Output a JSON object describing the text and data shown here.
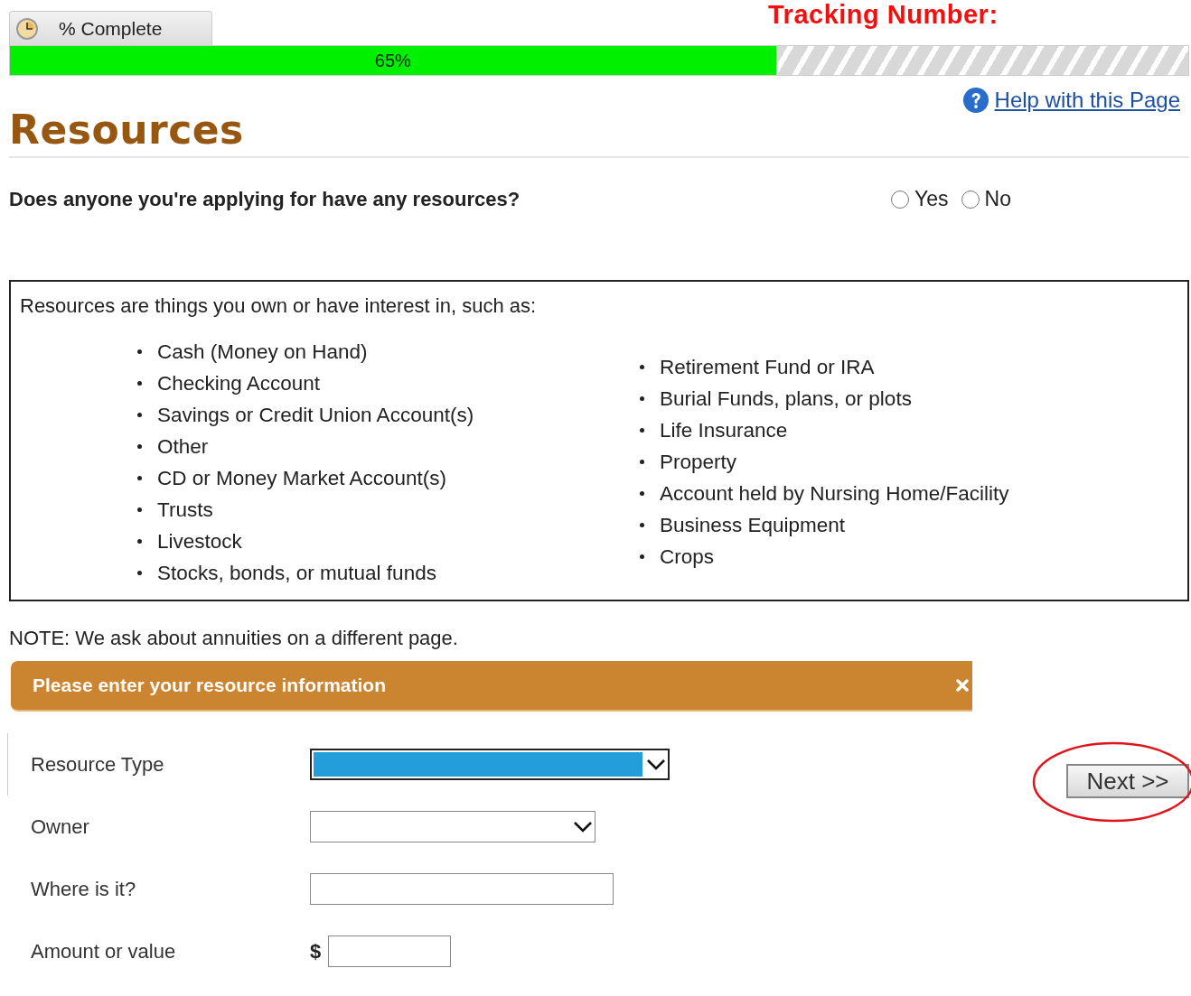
{
  "progress": {
    "tab_label": "% Complete",
    "level": 0.65,
    "reading": "65%"
  },
  "tracking": {
    "label": "Tracking Number:"
  },
  "help_link": "Help with this Page",
  "heading": "Resources",
  "question": {
    "text": "Does anyone you're applying for have any resources?",
    "options": [
      {
        "label": "Yes",
        "selected": false
      },
      {
        "label": "No",
        "selected": false
      }
    ]
  },
  "info_box": {
    "intro": "Resources are things you own or have interest in, such as:",
    "column_1": [
      "Cash (Money on Hand)",
      "Checking Account",
      "Savings or Credit Union Account(s)",
      "Other",
      "CD or Money Market Account(s)",
      "Trusts",
      "Livestock",
      "Stocks, bonds, or mutual funds"
    ],
    "column_2": [
      "Retirement Fund or IRA",
      "Burial Funds, plans, or plots",
      "Life Insurance",
      "Property",
      "Account held by Nursing Home/Facility",
      "Business Equipment",
      "Crops"
    ]
  },
  "note": "NOTE: We ask about annuities on a different page.",
  "panel": {
    "title": "Please enter your resource information"
  },
  "fields": [
    {
      "label": "Resource Type",
      "kind": "select",
      "focused": true
    },
    {
      "label": "Owner",
      "kind": "select",
      "focused": false
    },
    {
      "label": "Where is it?",
      "kind": "text",
      "focused": false
    },
    {
      "label": "Amount or value",
      "kind": "currency",
      "prefix": "$",
      "focused": false
    }
  ],
  "next_button": {
    "label": "Next >>",
    "circled": true
  }
}
